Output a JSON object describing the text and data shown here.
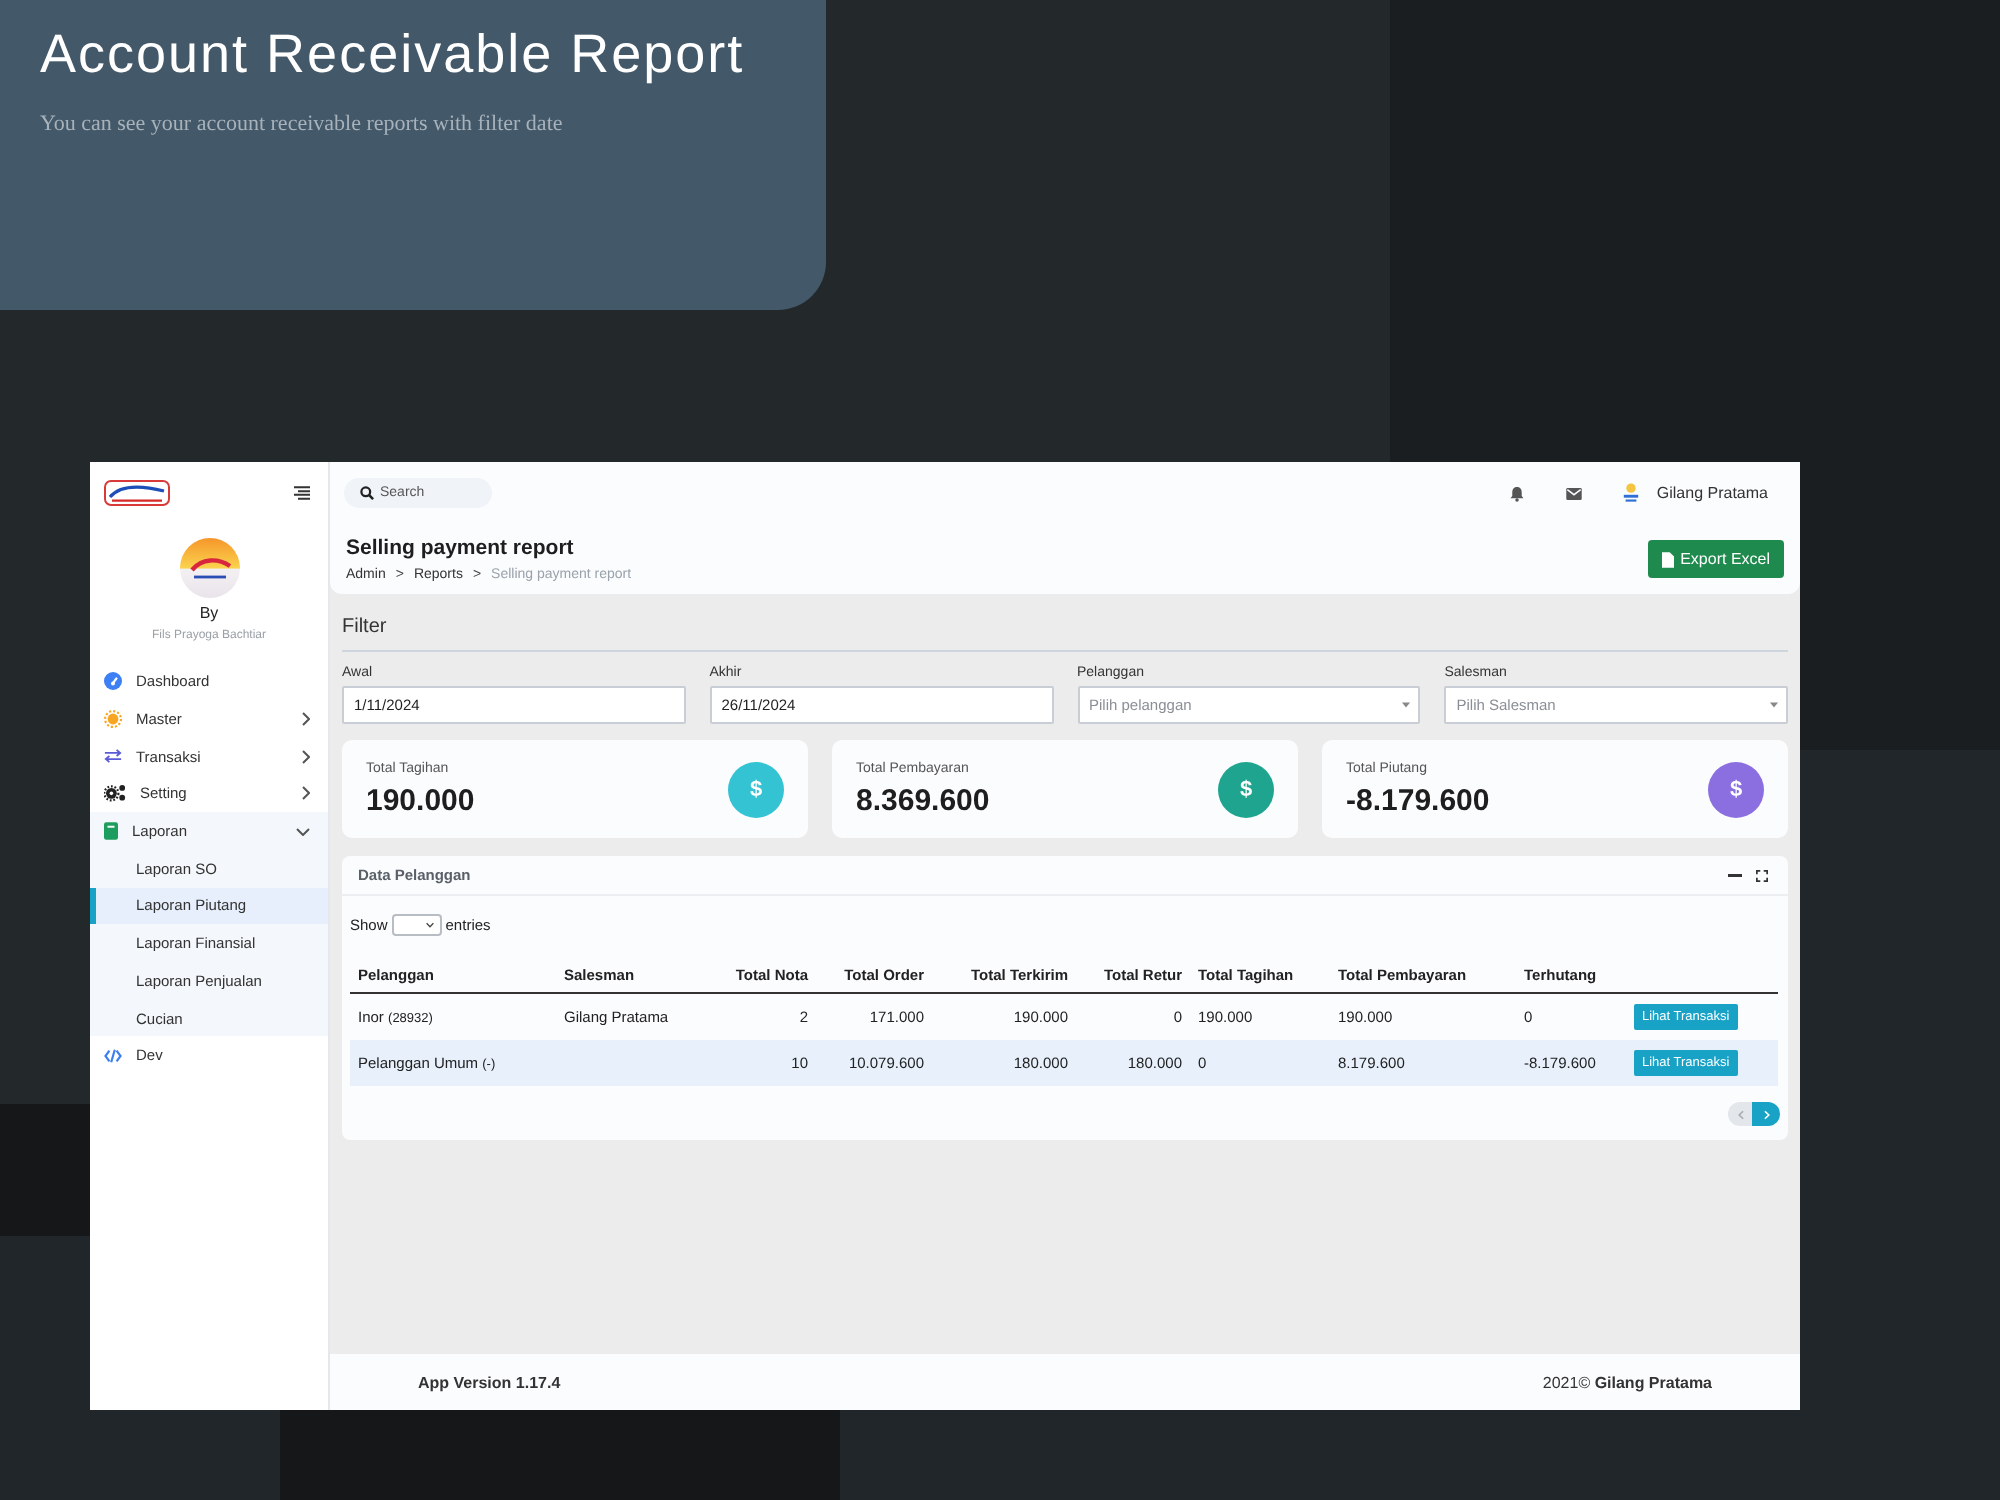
{
  "hero": {
    "title": "Account Receivable Report",
    "subtitle": "You can see your account receivable reports with filter date"
  },
  "sidebar": {
    "by_label": "By",
    "author": "Fils Prayoga Bachtiar",
    "items": [
      {
        "label": "Dashboard",
        "kind": "link",
        "selected": false
      },
      {
        "label": "Master",
        "kind": "group",
        "expanded": false,
        "selected": false
      },
      {
        "label": "Transaksi",
        "kind": "group",
        "expanded": false,
        "selected": false
      },
      {
        "label": "Setting",
        "kind": "group",
        "expanded": false,
        "selected": false
      },
      {
        "label": "Laporan",
        "kind": "group",
        "expanded": true,
        "selected": false,
        "children": [
          {
            "label": "Laporan SO",
            "selected": false
          },
          {
            "label": "Laporan Piutang",
            "selected": true
          },
          {
            "label": "Laporan Finansial",
            "selected": false
          },
          {
            "label": "Laporan Penjualan",
            "selected": false
          },
          {
            "label": "Cucian",
            "selected": false
          }
        ]
      },
      {
        "label": "Dev",
        "kind": "link",
        "selected": false
      }
    ]
  },
  "topbar": {
    "search_placeholder": "Search",
    "user_name": "Gilang Pratama"
  },
  "header": {
    "title": "Selling payment report",
    "breadcrumb": [
      {
        "label": "Admin",
        "current": false,
        "separator": ">"
      },
      {
        "label": "Reports",
        "current": false,
        "separator": ">"
      },
      {
        "label": "Selling payment report",
        "current": true
      }
    ],
    "export_button": "Export Excel"
  },
  "filter": {
    "title": "Filter",
    "fields": [
      {
        "label": "Awal",
        "kind": "input",
        "value": "1/11/2024"
      },
      {
        "label": "Akhir",
        "kind": "input",
        "value": "26/11/2024"
      },
      {
        "label": "Pelanggan",
        "kind": "select",
        "placeholder": "Pilih pelanggan"
      },
      {
        "label": "Salesman",
        "kind": "select",
        "placeholder": "Pilih Salesman"
      }
    ]
  },
  "summary_cards": [
    {
      "label": "Total Tagihan",
      "value": "190.000",
      "symbol": "$",
      "color": "#34c3d2"
    },
    {
      "label": "Total Pembayaran",
      "value": "8.369.600",
      "symbol": "$",
      "color": "#1fa58f"
    },
    {
      "label": "Total Piutang",
      "value": "-8.179.600",
      "symbol": "$",
      "color": "#8b6fe0"
    }
  ],
  "table_panel": {
    "title": "Data Pelanggan",
    "show_label": "Show",
    "entries_label": "entries",
    "columns": [
      "Pelanggan",
      "Salesman",
      "Total Nota",
      "Total Order",
      "Total Terkirim",
      "Total Retur",
      "Total Tagihan",
      "Total Pembayaran",
      "Terhutang"
    ],
    "rows": [
      {
        "customer": "Inor",
        "customer_code": "(28932)",
        "salesman": "Gilang Pratama",
        "total_nota": "2",
        "total_order": "171.000",
        "total_terkirim": "190.000",
        "total_retur": "0",
        "total_tagihan": "190.000",
        "total_pembayaran": "190.000",
        "terhutang": "0",
        "action": "Lihat Transaksi",
        "selected": false
      },
      {
        "customer": "Pelanggan Umum",
        "customer_code": "(-)",
        "total_nota": "10",
        "total_order": "10.079.600",
        "total_terkirim": "180.000",
        "total_retur": "180.000",
        "total_tagihan": "0",
        "total_pembayaran": "8.179.600",
        "terhutang": "-8.179.600",
        "action": "Lihat Transaksi",
        "selected": true
      }
    ],
    "pagination": [
      {
        "kind": "previous",
        "disabled": true
      },
      {
        "kind": "next",
        "disabled": false
      }
    ]
  },
  "footer": {
    "version": "App Version 1.17.4",
    "copyright": "2021© **Gilang Pratama**"
  }
}
